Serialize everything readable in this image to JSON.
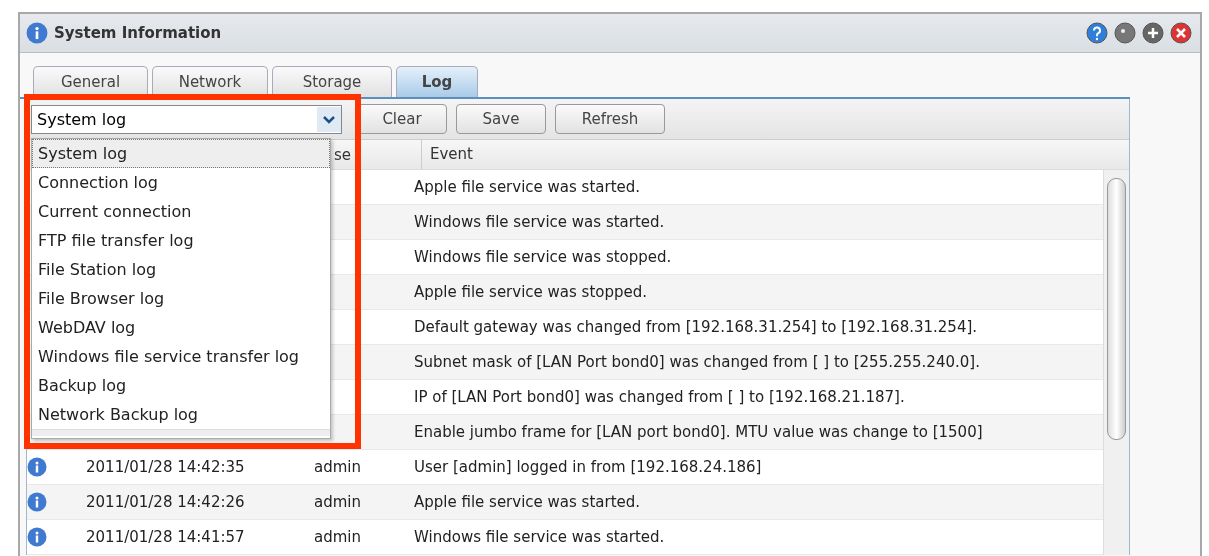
{
  "window": {
    "title": "System Information"
  },
  "tabs": [
    {
      "label": "General",
      "selected": false
    },
    {
      "label": "Network",
      "selected": false
    },
    {
      "label": "Storage",
      "selected": false
    },
    {
      "label": "Log",
      "selected": true
    }
  ],
  "toolbar": {
    "log_type": "System log",
    "buttons": [
      "Clear",
      "Save",
      "Refresh"
    ]
  },
  "dropdown": {
    "options": [
      {
        "label": "System log",
        "selected": true
      },
      {
        "label": "Connection log",
        "selected": false
      },
      {
        "label": "Current connection",
        "selected": false
      },
      {
        "label": "FTP file transfer log",
        "selected": false
      },
      {
        "label": "File Station log",
        "selected": false
      },
      {
        "label": "File Browser log",
        "selected": false
      },
      {
        "label": "WebDAV log",
        "selected": false
      },
      {
        "label": "Windows file service transfer log",
        "selected": false
      },
      {
        "label": "Backup log",
        "selected": false
      },
      {
        "label": "Network Backup log",
        "selected": false
      }
    ]
  },
  "table": {
    "columns": {
      "column_3": "se",
      "event": "Event"
    },
    "rows": [
      {
        "event": "Apple file service was started."
      },
      {
        "event": "Windows file service was started."
      },
      {
        "event": "Windows file service was stopped."
      },
      {
        "event": "Apple file service was stopped."
      },
      {
        "event": "Default gateway was changed from [192.168.31.254] to [192.168.31.254]."
      },
      {
        "event": "Subnet mask of [LAN Port bond0] was changed from [ ] to [255.255.240.0]."
      },
      {
        "event": "IP of [LAN Port bond0] was changed from [ ] to [192.168.21.187]."
      },
      {
        "event": "Enable jumbo frame for [LAN port bond0]. MTU value was change to [1500]"
      },
      {
        "date": "2011/01/28 14:42:35",
        "user": "admin",
        "event": "User [admin] logged in from [192.168.24.186]"
      },
      {
        "date": "2011/01/28 14:42:26",
        "user": "admin",
        "event": "Apple file service was started."
      },
      {
        "date": "2011/01/28 14:41:57",
        "user": "admin",
        "event": "Windows file service was started."
      }
    ]
  }
}
